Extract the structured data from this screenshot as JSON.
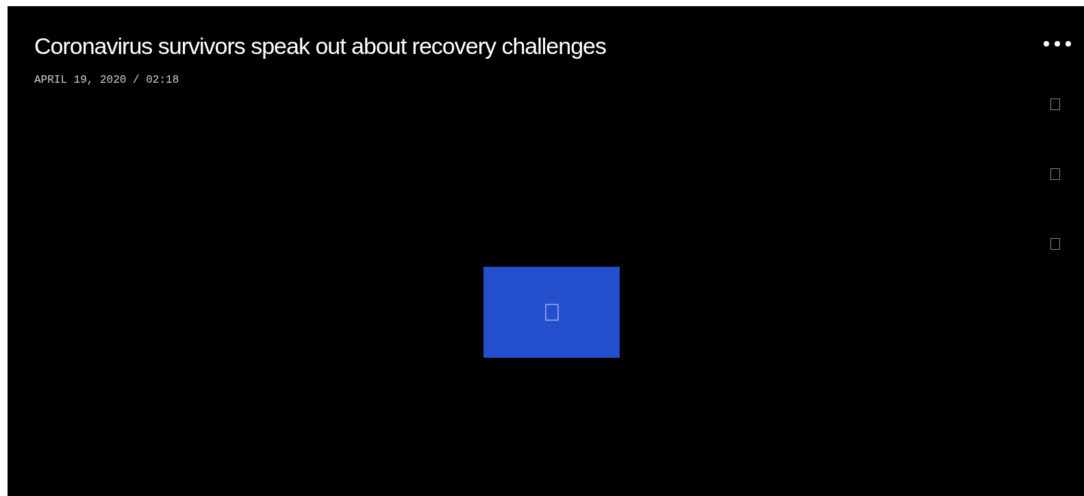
{
  "video": {
    "title": "Coronavirus survivors speak out about recovery challenges",
    "date": "APRIL 19, 2020 / 02:18"
  }
}
